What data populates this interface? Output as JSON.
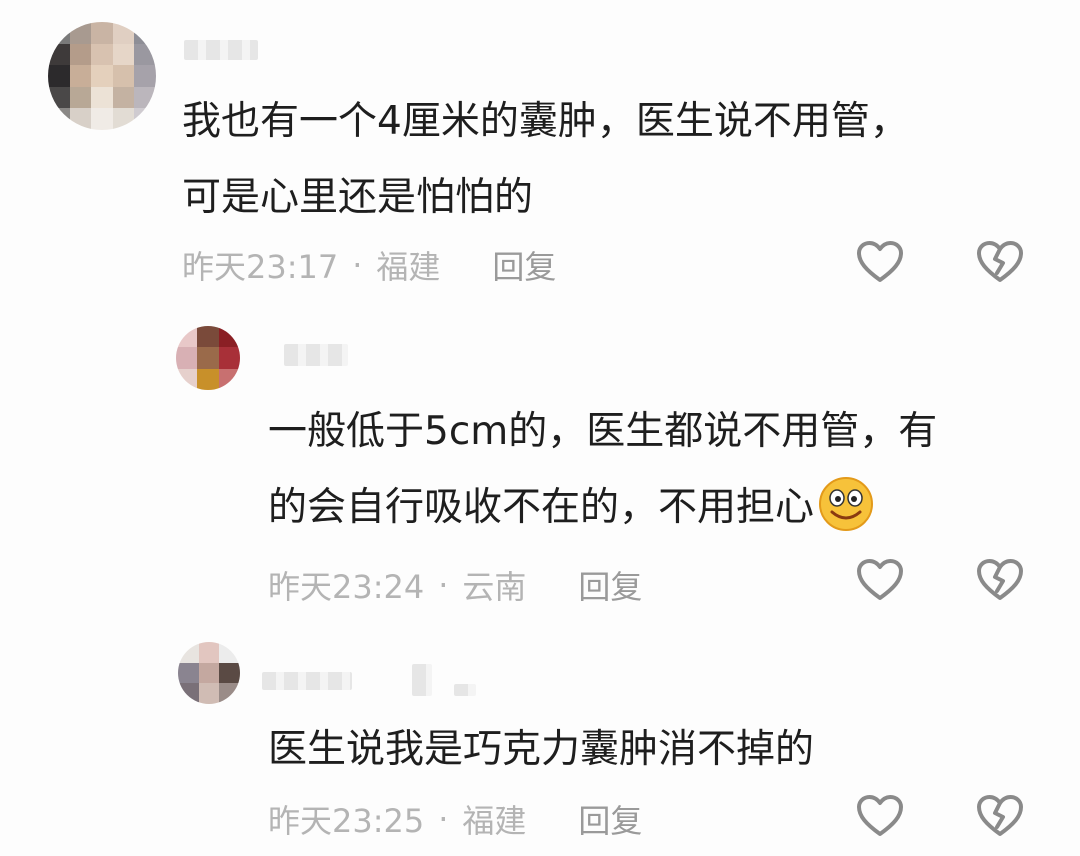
{
  "comments": [
    {
      "time": "昨天23:17",
      "location": "福建",
      "separator": "·",
      "reply_label": "回复",
      "text_line1": "我也有一个4厘米的囊肿，医生说不用管，",
      "text_line2": "可是心里还是怕怕的"
    },
    {
      "time": "昨天23:24",
      "location": "云南",
      "separator": "·",
      "reply_label": "回复",
      "text_line1": "一般低于5cm的，医生都说不用管，有",
      "text_line2": "的会自行吸收不在的，不用担心",
      "emoji": "smile-emoji"
    },
    {
      "time": "昨天23:25",
      "location": "福建",
      "separator": "·",
      "reply_label": "回复",
      "text_line1": "医生说我是巧克力囊肿消不掉的"
    }
  ],
  "icons": {
    "like": "heart-icon",
    "dislike": "broken-heart-icon"
  },
  "colors": {
    "text": "#1e1e1e",
    "meta": "#b4b4b4",
    "icon_stroke": "#8a8a8a"
  }
}
